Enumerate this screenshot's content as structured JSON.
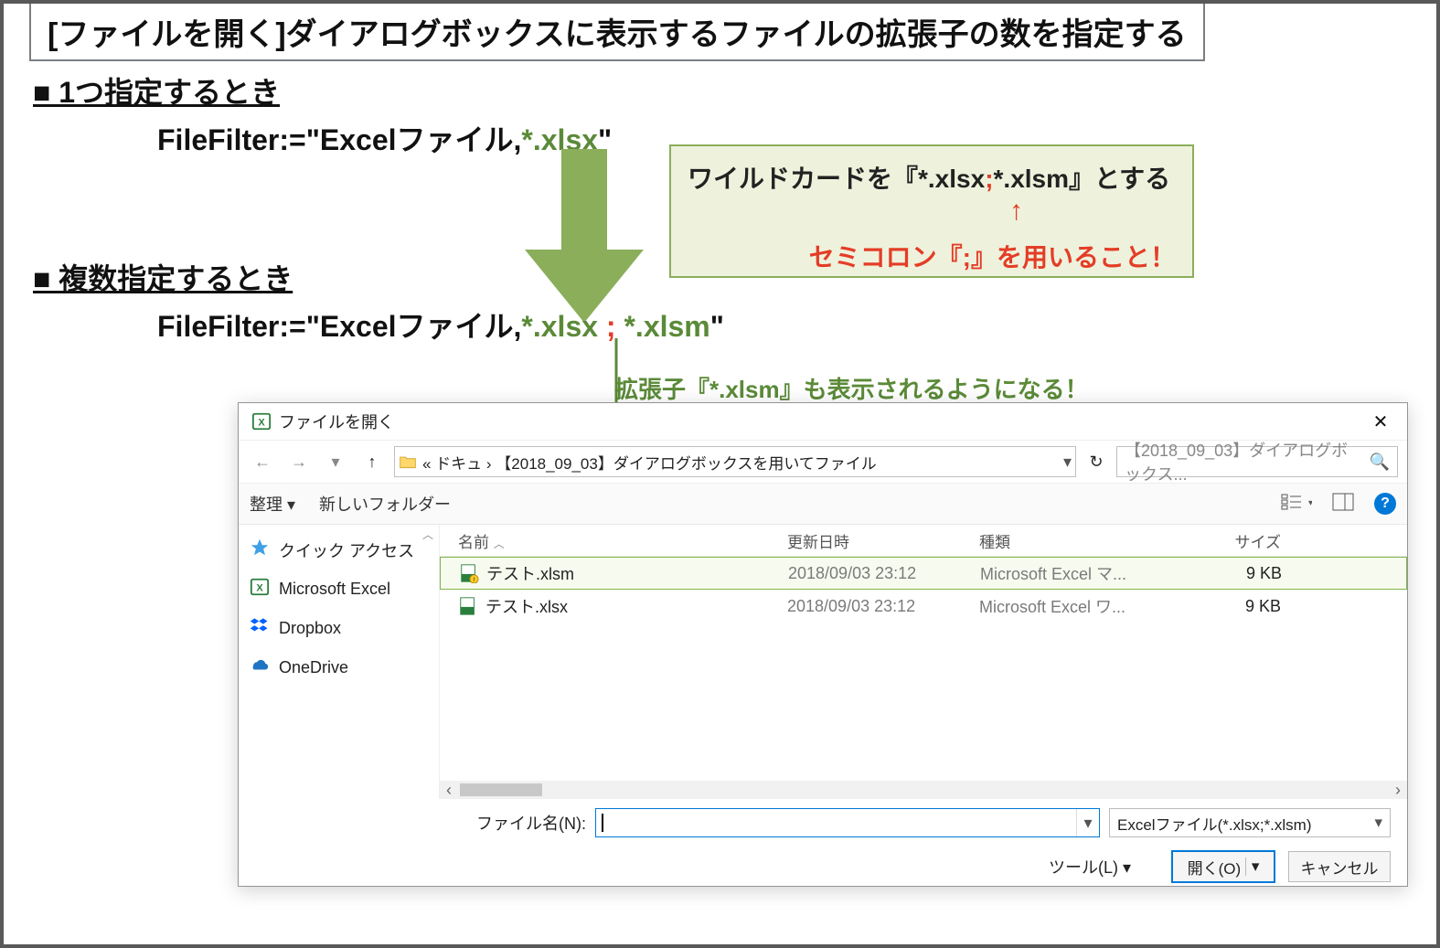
{
  "title": "[ファイルを開く]ダイアログボックスに表示するファイルの拡張子の数を指定する",
  "sec1": {
    "heading": "■ 1つ指定するとき",
    "code_prefix": "FileFilter:=\"Excelファイル,",
    "code_ext": "*.xlsx",
    "code_suffix": "\""
  },
  "callout": {
    "line1_pre": "ワイルドカードを『*.xlsx",
    "line1_semi": ";",
    "line1_post": "*.xlsm』とする",
    "line2": "セミコロン『;』を用いること！"
  },
  "sec2": {
    "heading": "■ 複数指定するとき",
    "code_prefix": "FileFilter:=\"Excelファイル,",
    "code_ext1": "*.xlsx",
    "code_semi": " ; ",
    "code_ext2": "*.xlsm",
    "code_suffix": "\""
  },
  "note": "拡張子『*.xlsm』も表示されるようになる！",
  "dialog": {
    "title": "ファイルを開く",
    "crumbs": "« ドキュ › 【2018_09_03】ダイアログボックスを用いてファイル",
    "search_placeholder": "【2018_09_03】ダイアログボックス...",
    "toolbar": {
      "organize": "整理 ▾",
      "newfolder": "新しいフォルダー"
    },
    "nav": {
      "quick": "クイック アクセス",
      "excel": "Microsoft Excel",
      "dropbox": "Dropbox",
      "onedrive": "OneDrive"
    },
    "columns": {
      "name": "名前",
      "date": "更新日時",
      "type": "種類",
      "size": "サイズ"
    },
    "files": [
      {
        "name": "テスト.xlsm",
        "date": "2018/09/03 23:12",
        "type": "Microsoft Excel マ...",
        "size": "9 KB",
        "highlight": true
      },
      {
        "name": "テスト.xlsx",
        "date": "2018/09/03 23:12",
        "type": "Microsoft Excel ワ...",
        "size": "9 KB",
        "highlight": false
      }
    ],
    "filename_label": "ファイル名(N):",
    "filter_value": "Excelファイル(*.xlsx;*.xlsm)",
    "tools": "ツール(L) ▾",
    "open": "開く(O)",
    "cancel": "キャンセル"
  }
}
